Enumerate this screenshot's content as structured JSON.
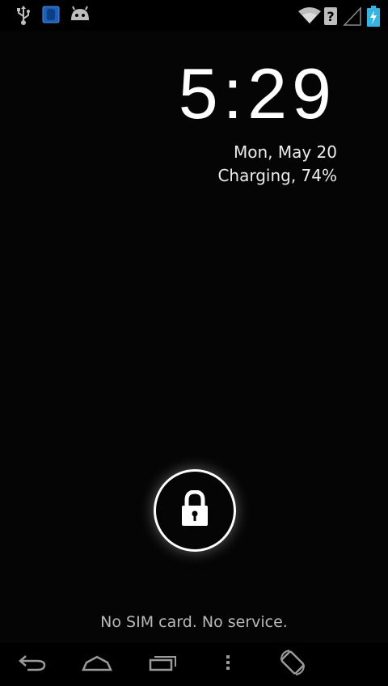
{
  "statusbar": {
    "left_icons": [
      "usb-icon",
      "app-notification-icon",
      "android-icon"
    ],
    "right_icons": [
      "wifi-icon",
      "unknown-wifi-icon",
      "signal-icon",
      "battery-charging-icon"
    ]
  },
  "lockscreen": {
    "time": "5:29",
    "date": "Mon, May 20",
    "charging_status": "Charging, 74%",
    "lock_icon": "lock-icon",
    "carrier_text": "No SIM card. No service."
  },
  "navbar": {
    "buttons": [
      "back-icon",
      "home-icon",
      "recent-apps-icon",
      "menu-icon",
      "rotate-icon"
    ]
  },
  "colors": {
    "background": "#050505",
    "accent_blue": "#33b5e5",
    "text": "#ffffff"
  }
}
